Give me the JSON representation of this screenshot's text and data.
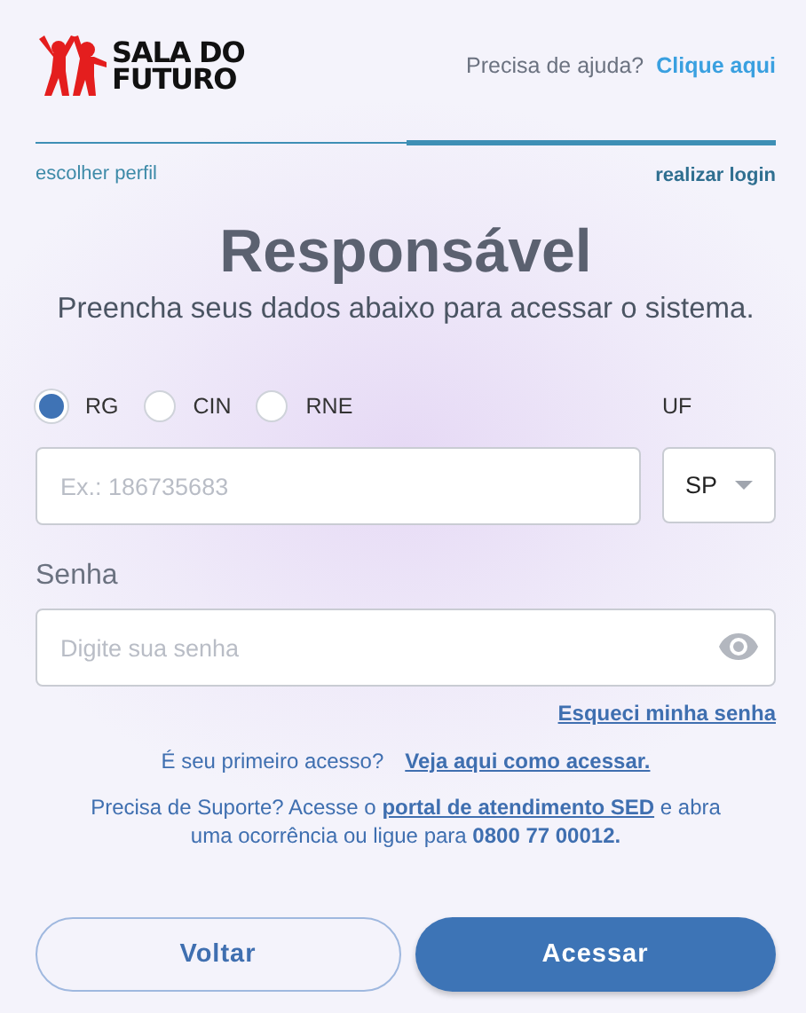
{
  "header": {
    "logo_text": "SALA DO FUTURO",
    "help_prompt": "Precisa de ajuda?",
    "help_link": "Clique aqui"
  },
  "steps": [
    {
      "label": "escolher perfil",
      "selected": false
    },
    {
      "label": "realizar login",
      "selected": true
    }
  ],
  "title": "Responsável",
  "subtitle": "Preencha seus dados abaixo para acessar o sistema.",
  "document_types": [
    {
      "label": "RG",
      "selected": true
    },
    {
      "label": "CIN",
      "selected": false
    },
    {
      "label": "RNE",
      "selected": false
    }
  ],
  "document_field": {
    "placeholder": "Ex.: 186735683"
  },
  "uf": {
    "label": "UF",
    "value": "SP"
  },
  "password": {
    "label": "Senha",
    "placeholder": "Digite sua senha"
  },
  "forgot_link": "Esqueci minha senha",
  "first_access": {
    "prompt": "É seu primeiro acesso?",
    "link": "Veja aqui como acessar."
  },
  "support": [
    {
      "kind": "text",
      "text": "Precisa de Suporte? Acesse o "
    },
    {
      "kind": "link",
      "text": "portal de atendimento SED"
    },
    {
      "kind": "text",
      "text": " e abra uma ocorrência ou ligue para "
    },
    {
      "kind": "bold",
      "text": "0800 77 00012."
    }
  ],
  "buttons": [
    {
      "label": "Voltar",
      "kind": "secondary"
    },
    {
      "label": "Acessar",
      "kind": "primary"
    }
  ]
}
